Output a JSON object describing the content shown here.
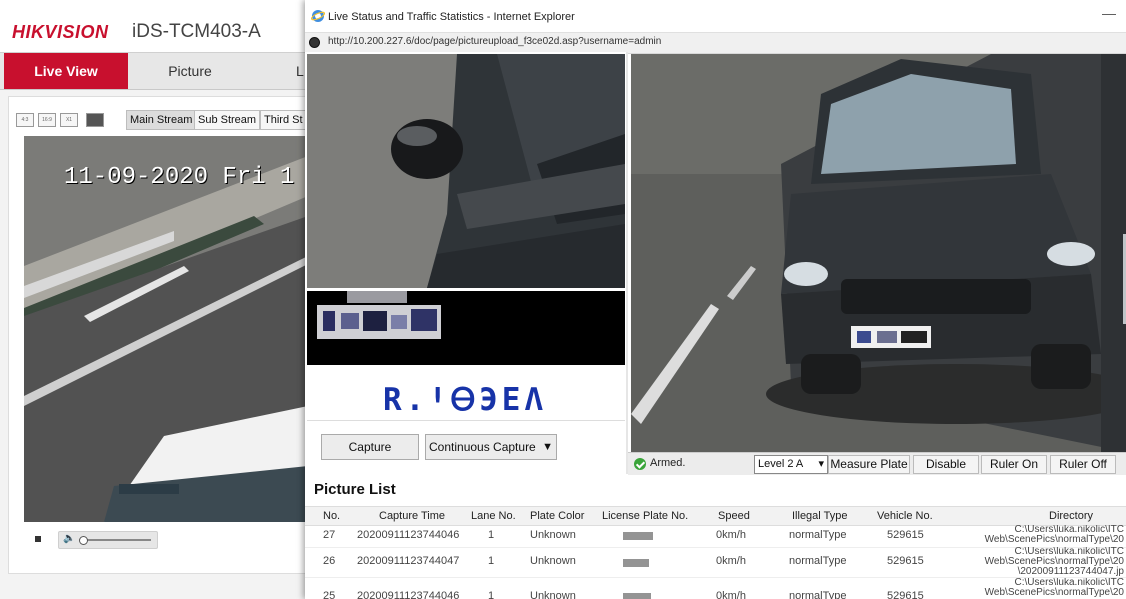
{
  "background_app": {
    "brand": "HIKVISION",
    "device_name": "iDS-TCM403-A",
    "nav_tabs": [
      "Live View",
      "Picture",
      "L"
    ],
    "stream_buttons": {
      "main": "Main Stream",
      "sub": "Sub Stream",
      "third": "Third St"
    },
    "aspect_buttons": [
      "4:3",
      "16:9",
      "X1"
    ],
    "osd_text": "11-09-2020 Fri 1"
  },
  "ie_window": {
    "title": "Live Status and Traffic Statistics - Internet Explorer",
    "url": "http://10.200.227.6/doc/page/pictureupload_f3ce02d.asp?username=admin",
    "minimize_glyph": "—"
  },
  "plate_panel": {
    "recognized_plate": "R.ꞋᎾЭΕΛ",
    "capture_label": "Capture",
    "continuous_capture_label": "Continuous Capture",
    "dropdown_arrow": "▼"
  },
  "control_bar": {
    "status": "Armed.",
    "level": "Level 2 A",
    "level_arrow": "▾",
    "measure_plate": "Measure Plate",
    "disable": "Disable",
    "ruler_on": "Ruler On",
    "ruler_off": "Ruler Off"
  },
  "picture_list": {
    "title": "Picture List",
    "columns": [
      "No.",
      "Capture Time",
      "Lane No.",
      "Plate Color",
      "License Plate No.",
      "Speed",
      "Illegal Type",
      "Vehicle No.",
      "Directory"
    ],
    "rows": [
      {
        "no": "27",
        "time": "20200911123744046",
        "lane": "1",
        "color": "Unknown",
        "speed": "0km/h",
        "illegal": "normalType",
        "vehicle": "529615",
        "dir": [
          "C:\\Users\\luka.nikolic\\ITC",
          "Web\\ScenePics\\normalType\\20"
        ]
      },
      {
        "no": "26",
        "time": "20200911123744047",
        "lane": "1",
        "color": "Unknown",
        "speed": "0km/h",
        "illegal": "normalType",
        "vehicle": "529615",
        "dir": [
          "C:\\Users\\luka.nikolic\\ITC",
          "Web\\ScenePics\\normalType\\20",
          "\\20200911123744047.jp"
        ]
      },
      {
        "no": "25",
        "time": "20200911123744046",
        "lane": "1",
        "color": "Unknown",
        "speed": "0km/h",
        "illegal": "normalType",
        "vehicle": "529615",
        "dir": [
          "C:\\Users\\luka.nikolic\\ITC",
          "Web\\ScenePics\\normalType\\20"
        ]
      }
    ]
  },
  "colors": {
    "brand_red": "#c8102e",
    "plate_text_blue": "#1733a8",
    "armed_green": "#3aa53a"
  }
}
